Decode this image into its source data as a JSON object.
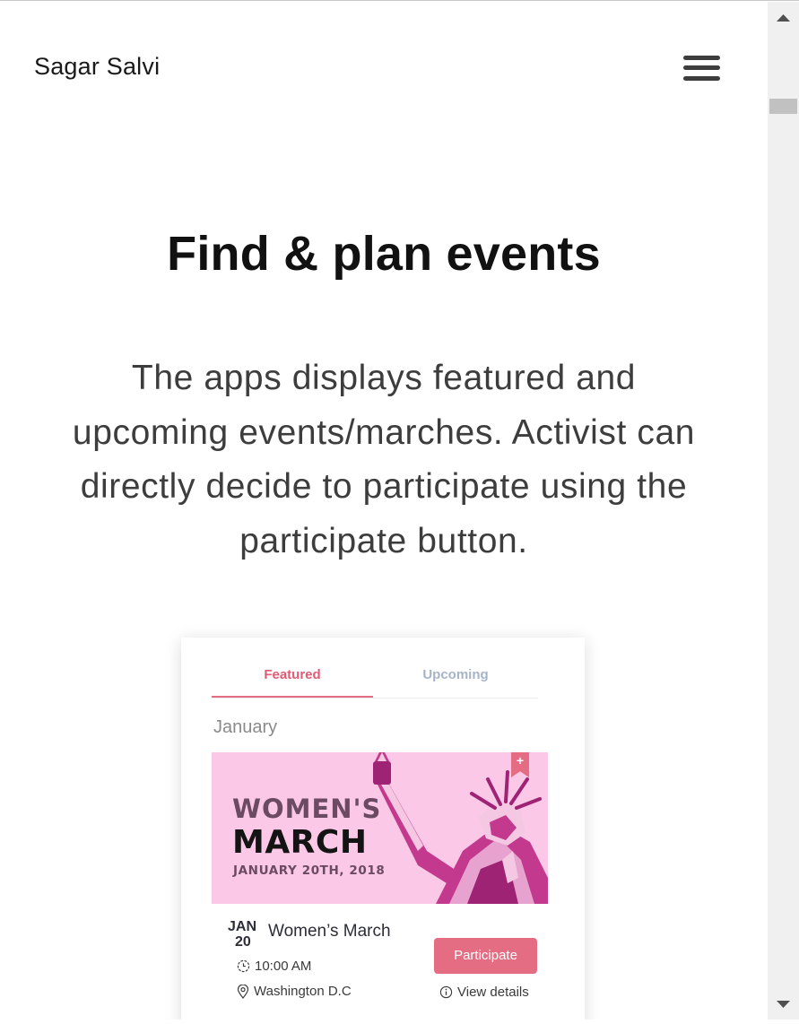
{
  "header": {
    "site_title": "Sagar Salvi",
    "menu_icon": "hamburger-menu-icon"
  },
  "hero": {
    "heading": "Find & plan events",
    "description": "The apps displays featured and upcoming events/marches. Activist can directly decide to participate using the participate button."
  },
  "app_preview": {
    "tabs": [
      {
        "label": "Featured",
        "active": true
      },
      {
        "label": "Upcoming",
        "active": false
      }
    ],
    "month": "January",
    "event": {
      "banner": {
        "line1": "WOMEN'S",
        "line2": "MARCH",
        "line3": "JANUARY 20TH, 2018",
        "bookmark_symbol": "+"
      },
      "month": "JAN",
      "day": "20",
      "title": "Women’s March",
      "time": "10:00 AM",
      "location": "Washington D.C",
      "participate_label": "Participate",
      "details_label": "View details"
    }
  },
  "colors": {
    "accent": "#e46d83",
    "inactive_tab": "#a7b4c8",
    "banner_bg": "#fbc9e7",
    "text_dark": "#2d2d3a"
  }
}
